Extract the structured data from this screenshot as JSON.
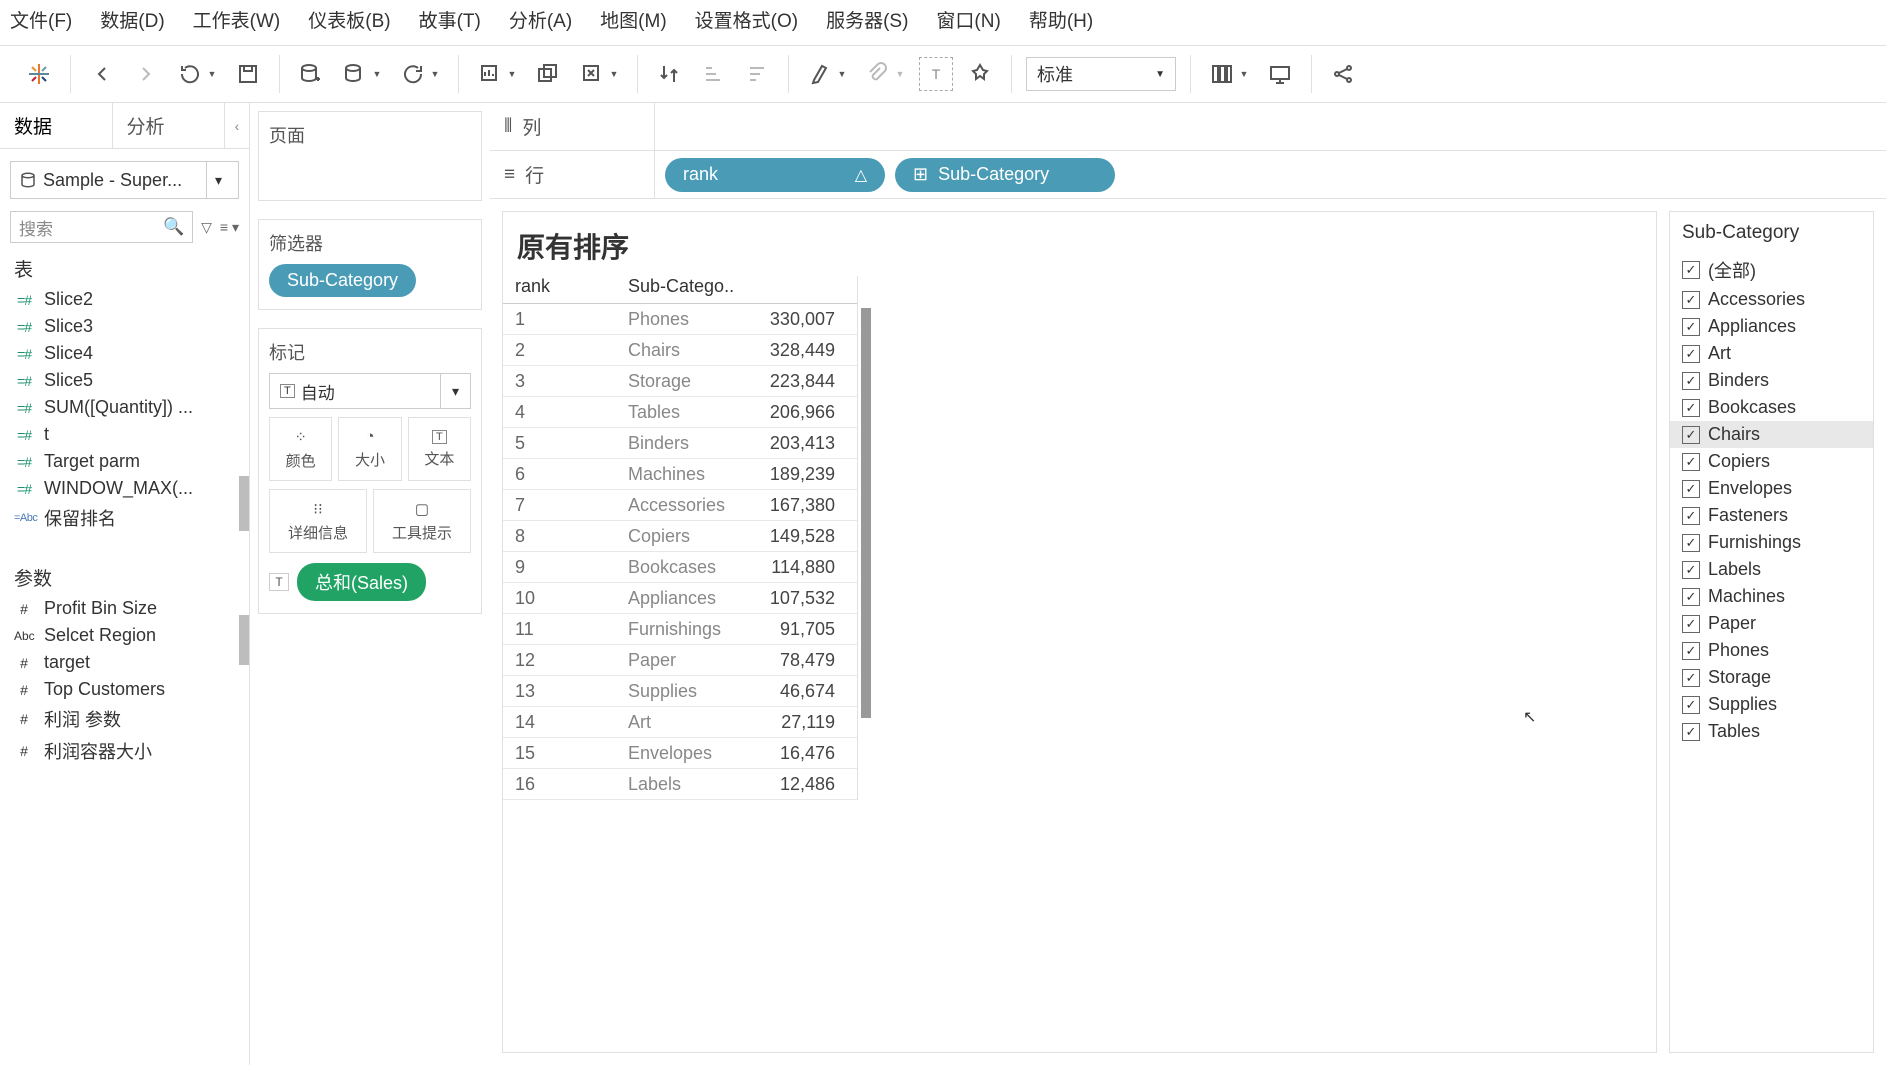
{
  "menu": [
    "文件(F)",
    "数据(D)",
    "工作表(W)",
    "仪表板(B)",
    "故事(T)",
    "分析(A)",
    "地图(M)",
    "设置格式(O)",
    "服务器(S)",
    "窗口(N)",
    "帮助(H)"
  ],
  "toolbar": {
    "fit_label": "标准"
  },
  "sidepane": {
    "tab_data": "数据",
    "tab_analysis": "分析",
    "datasource": "Sample - Super...",
    "search_placeholder": "搜索",
    "section_tables": "表",
    "section_params": "参数",
    "fields": [
      {
        "icon": "hash",
        "label": "Slice2"
      },
      {
        "icon": "hash",
        "label": "Slice3"
      },
      {
        "icon": "hash",
        "label": "Slice4"
      },
      {
        "icon": "hash",
        "label": "Slice5"
      },
      {
        "icon": "hash",
        "label": "SUM([Quantity]) ..."
      },
      {
        "icon": "hash",
        "label": "t"
      },
      {
        "icon": "hash",
        "label": "Target parm"
      },
      {
        "icon": "hash",
        "label": "WINDOW_MAX(..."
      },
      {
        "icon": "abc",
        "label": "保留排名"
      }
    ],
    "params": [
      {
        "icon": "plain",
        "label": "Profit Bin Size"
      },
      {
        "icon": "pabc",
        "label": "Selcet Region"
      },
      {
        "icon": "plain",
        "label": "target"
      },
      {
        "icon": "plain",
        "label": "Top Customers"
      },
      {
        "icon": "plain",
        "label": "利润 参数"
      },
      {
        "icon": "plain",
        "label": "利润容器大小"
      }
    ]
  },
  "cards": {
    "pages": "页面",
    "filters": "筛选器",
    "filter_pill": "Sub-Category",
    "marks": "标记",
    "marks_auto": "自动",
    "mark_cells": [
      "颜色",
      "大小",
      "文本",
      "详细信息",
      "工具提示"
    ],
    "text_pill": "总和(Sales)"
  },
  "shelves": {
    "columns": "列",
    "rows": "行",
    "row_pills": [
      {
        "label": "rank",
        "tail": "△"
      },
      {
        "label": "Sub-Category",
        "lead": "⊞"
      }
    ]
  },
  "viz": {
    "title": "原有排序",
    "head": {
      "c1": "rank",
      "c2": "Sub-Catego.."
    },
    "rows": [
      {
        "r": "1",
        "s": "Phones",
        "v": "330,007"
      },
      {
        "r": "2",
        "s": "Chairs",
        "v": "328,449"
      },
      {
        "r": "3",
        "s": "Storage",
        "v": "223,844"
      },
      {
        "r": "4",
        "s": "Tables",
        "v": "206,966"
      },
      {
        "r": "5",
        "s": "Binders",
        "v": "203,413"
      },
      {
        "r": "6",
        "s": "Machines",
        "v": "189,239"
      },
      {
        "r": "7",
        "s": "Accessories",
        "v": "167,380"
      },
      {
        "r": "8",
        "s": "Copiers",
        "v": "149,528"
      },
      {
        "r": "9",
        "s": "Bookcases",
        "v": "114,880"
      },
      {
        "r": "10",
        "s": "Appliances",
        "v": "107,532"
      },
      {
        "r": "11",
        "s": "Furnishings",
        "v": "91,705"
      },
      {
        "r": "12",
        "s": "Paper",
        "v": "78,479"
      },
      {
        "r": "13",
        "s": "Supplies",
        "v": "46,674"
      },
      {
        "r": "14",
        "s": "Art",
        "v": "27,119"
      },
      {
        "r": "15",
        "s": "Envelopes",
        "v": "16,476"
      },
      {
        "r": "16",
        "s": "Labels",
        "v": "12,486"
      }
    ]
  },
  "filtercard": {
    "title": "Sub-Category",
    "items": [
      "(全部)",
      "Accessories",
      "Appliances",
      "Art",
      "Binders",
      "Bookcases",
      "Chairs",
      "Copiers",
      "Envelopes",
      "Fasteners",
      "Furnishings",
      "Labels",
      "Machines",
      "Paper",
      "Phones",
      "Storage",
      "Supplies",
      "Tables"
    ],
    "hover_index": 6
  },
  "chart_data": {
    "type": "table",
    "title": "原有排序",
    "columns": [
      "rank",
      "Sub-Category",
      "Sales"
    ],
    "rows": [
      [
        1,
        "Phones",
        330007
      ],
      [
        2,
        "Chairs",
        328449
      ],
      [
        3,
        "Storage",
        223844
      ],
      [
        4,
        "Tables",
        206966
      ],
      [
        5,
        "Binders",
        203413
      ],
      [
        6,
        "Machines",
        189239
      ],
      [
        7,
        "Accessories",
        167380
      ],
      [
        8,
        "Copiers",
        149528
      ],
      [
        9,
        "Bookcases",
        114880
      ],
      [
        10,
        "Appliances",
        107532
      ],
      [
        11,
        "Furnishings",
        91705
      ],
      [
        12,
        "Paper",
        78479
      ],
      [
        13,
        "Supplies",
        46674
      ],
      [
        14,
        "Art",
        27119
      ],
      [
        15,
        "Envelopes",
        16476
      ],
      [
        16,
        "Labels",
        12486
      ]
    ]
  }
}
